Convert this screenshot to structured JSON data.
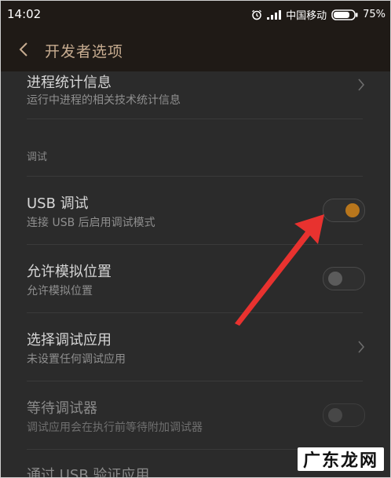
{
  "status_bar": {
    "time": "14:02",
    "carrier": "中国移动",
    "battery": "75%",
    "icons": [
      "alarm-icon",
      "signal-icon",
      "battery-icon"
    ]
  },
  "app_bar": {
    "title": "开发者选项",
    "back_icon": "chevron-left-icon"
  },
  "settings": {
    "process_stats": {
      "title": "进程统计信息",
      "subtitle": "运行中进程的相关技术统计信息"
    },
    "debug_section": {
      "label": "调试"
    },
    "usb_debugging": {
      "title": "USB 调试",
      "subtitle": "连接 USB 后启用调试模式",
      "enabled": true
    },
    "mock_location": {
      "title": "允许模拟位置",
      "subtitle": "允许模拟位置",
      "enabled": false
    },
    "select_debug_app": {
      "title": "选择调试应用",
      "subtitle": "未设置任何调试应用"
    },
    "wait_for_debugger": {
      "title": "等待调试器",
      "subtitle": "调试应用会在执行前等待附加调试器",
      "enabled": false,
      "disabled_row": true
    },
    "verify_apps_usb": {
      "title": "通过 USB 验证应用"
    }
  },
  "overlay": {
    "watermark_text": "广东龙网",
    "arrow_color": "#e8322f"
  },
  "colors": {
    "accent": "#b8761c",
    "header_bg": "#1f1a16",
    "title_accent": "#c8ad91"
  }
}
